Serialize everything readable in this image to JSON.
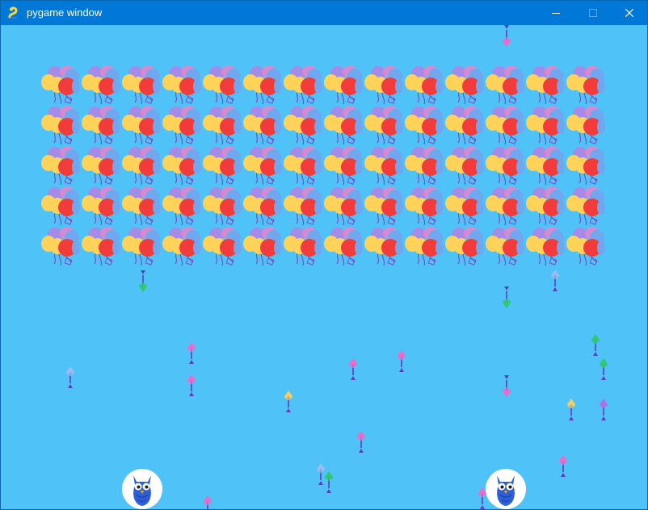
{
  "window": {
    "title": "pygame window",
    "icon": "pygame-snake-icon",
    "controls": [
      "minimize",
      "maximize",
      "close"
    ]
  },
  "game": {
    "background_color": "#4fc3f7",
    "balloon_grid": {
      "rows": 5,
      "cols": 14
    },
    "balloon_colors": {
      "red": "#f23c3c",
      "yellow": "#ffd25a",
      "blue": "#6fa8ee",
      "purple": "#a58be8",
      "pink": "#f080c8",
      "string": "#7a4ec6"
    },
    "dart_colors": {
      "pink": "#f06acb",
      "purple": "#b06ee8",
      "blue": "#9dbbf0",
      "yellow": "#f5d060",
      "green": "#30c870",
      "shaft": "#5a3fc0"
    },
    "owls": [
      "player-owl-left",
      "player-owl-right"
    ]
  }
}
